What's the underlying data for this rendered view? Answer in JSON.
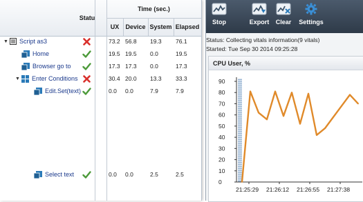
{
  "script_panel": {
    "columns": {
      "status": "Statu",
      "time_group": "Time (sec.)",
      "ux": "UX",
      "device": "Device",
      "system": "System",
      "elapsed": "Elapsed"
    },
    "rows": [
      {
        "label": "Script as3",
        "level": 0,
        "toggle": "▼",
        "icon": "script-icon",
        "status": "fail",
        "ux": "73.2",
        "device": "56.8",
        "system": "19.3",
        "elapsed": "76.1"
      },
      {
        "label": "Home",
        "level": 1,
        "toggle": "",
        "icon": "step-icon",
        "status": "pass",
        "ux": "19.5",
        "device": "19.5",
        "system": "0.0",
        "elapsed": "19.5"
      },
      {
        "label": "Browser go to",
        "level": 1,
        "toggle": "",
        "icon": "step-icon",
        "status": "pass",
        "ux": "17.3",
        "device": "17.3",
        "system": "0.0",
        "elapsed": "17.3"
      },
      {
        "label": "Enter Conditions",
        "level": 1,
        "toggle": "▼",
        "icon": "group-icon",
        "status": "fail",
        "ux": "30.4",
        "device": "20.0",
        "system": "13.3",
        "elapsed": "33.3"
      },
      {
        "label": "Edit.Set(text)",
        "level": 2,
        "toggle": "",
        "icon": "step-icon",
        "status": "pass",
        "ux": "0.0",
        "device": "0.0",
        "system": "7.9",
        "elapsed": "7.9"
      },
      {
        "label": "Select text",
        "level": 2,
        "toggle": "",
        "icon": "step-icon",
        "status": "pass",
        "ux": "0.0",
        "device": "0.0",
        "system": "2.5",
        "elapsed": "2.5"
      }
    ]
  },
  "vitals_panel": {
    "toolbar": {
      "stop": "Stop",
      "export": "Export",
      "clear": "Clear",
      "settings": "Settings"
    },
    "status_text": "Status: Collecting vitals information(9 vitals)",
    "started_text": "Started: Tue Sep 30 2014 09:25:28",
    "chart_title": "CPU User, %"
  },
  "colors": {
    "line": "#e08a2a",
    "fail": "#d9302c",
    "pass": "#4c9a3a",
    "toolbar": "#3a4757",
    "icon_blue": "#2a7ab8"
  },
  "chart_data": {
    "type": "line",
    "title": "CPU User, %",
    "x_ticks": [
      "21:25:29",
      "21:26:12",
      "21:26:55",
      "21:27:38"
    ],
    "ylim": [
      0,
      90
    ],
    "y_ticks": [
      0,
      10,
      20,
      30,
      40,
      50,
      60,
      70,
      80,
      90
    ],
    "grid": false,
    "series": [
      {
        "x": [
          0,
          2,
          4,
          6,
          8,
          10,
          12,
          14,
          16,
          18,
          20,
          22,
          24,
          26,
          28
        ],
        "y": [
          0,
          81,
          62,
          56,
          81,
          59,
          80,
          52,
          79,
          42,
          48,
          58,
          68,
          78,
          70
        ]
      }
    ]
  }
}
